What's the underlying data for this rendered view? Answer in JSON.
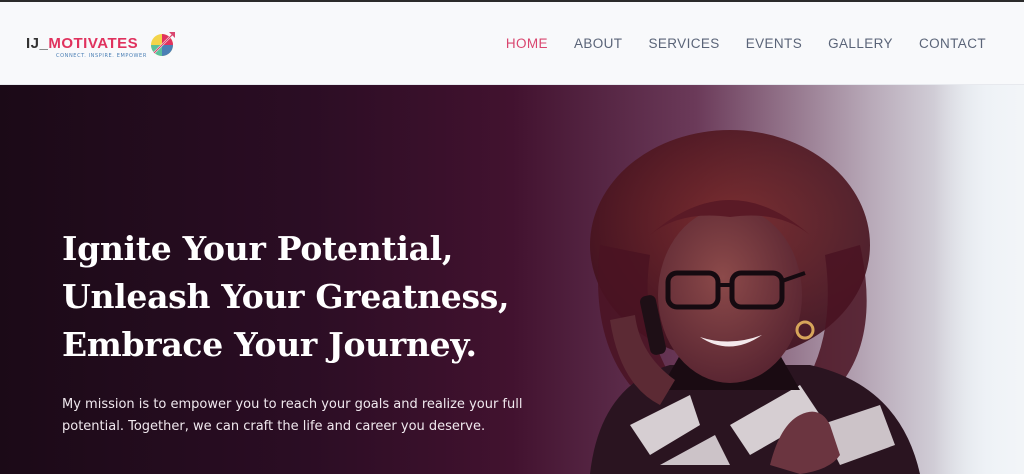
{
  "brand": {
    "name_prefix": "IJ_",
    "name_main": "MOTIVATES",
    "tagline": "CONNECT. INSPIRE. EMPOWER"
  },
  "nav": {
    "items": [
      {
        "label": "HOME",
        "active": true
      },
      {
        "label": "ABOUT",
        "active": false
      },
      {
        "label": "SERVICES",
        "active": false
      },
      {
        "label": "EVENTS",
        "active": false
      },
      {
        "label": "GALLERY",
        "active": false
      },
      {
        "label": "CONTACT",
        "active": false
      }
    ]
  },
  "hero": {
    "title_lines": [
      "Ignite Your Potential,",
      "Unleash Your Greatness,",
      "Embrace Your Journey."
    ],
    "description": "My mission is to empower you to reach your goals and realize your full potential. Together, we can craft the life and career you deserve."
  },
  "colors": {
    "accent": "#d9466f",
    "nav_text": "#5a6478",
    "hero_dark": "#2b0d24",
    "header_bg": "#f8f9fb"
  }
}
